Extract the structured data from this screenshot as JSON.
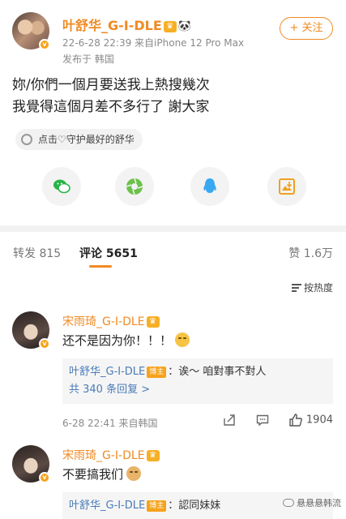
{
  "post": {
    "username": "叶舒华_G-I-DLE",
    "crown_badge": "crown-icon",
    "panda_badge": "panda-icon",
    "timestamp_line": "22-6-28 22:39  来自iPhone 12 Pro Max",
    "location_line": "发布于 韩国",
    "follow_label": "+ 关注",
    "text_line1": "妳/你們一個月要送我上熱搜幾次",
    "text_line2": "我覺得這個月差不多行了 謝大家",
    "support_chip": "点击♡守护最好的舒华"
  },
  "share_icons": [
    "wechat-icon",
    "moments-icon",
    "qq-icon",
    "save-image-icon"
  ],
  "tabs": {
    "repost": "转发 815",
    "comments": "评论 5651",
    "likes": "赞 1.6万"
  },
  "sort_label": "按热度",
  "comments": [
    {
      "name": "宋雨琦_G-I-DLE",
      "text": "还不是因为你！！！",
      "reply_author": "叶舒华_G-I-DLE",
      "reply_tag": "博主",
      "reply_text": "：诶～ 咱對事不對人",
      "reply_count": "共 340 条回复 >",
      "footer": "6-28 22:41  来自韩国",
      "like_count": "1904"
    },
    {
      "name": "宋雨琦_G-I-DLE",
      "text": "不要搞我们",
      "reply_author": "叶舒华_G-I-DLE",
      "reply_tag": "博主",
      "reply_text": "：認同妹妹"
    }
  ],
  "watermark": "悬悬悬韩流",
  "colors": {
    "accent": "#f08a23",
    "link": "#4a7bb7",
    "badge": "#f7a21b"
  }
}
